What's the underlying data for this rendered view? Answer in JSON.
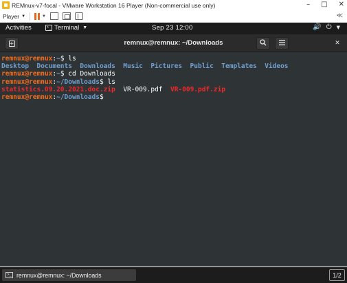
{
  "vm_window": {
    "title": "REMnux-v7-focal - VMware Workstation 16 Player (Non-commercial use only)",
    "controls": [
      "–",
      "□",
      "✕"
    ]
  },
  "vm_toolbar": {
    "player_label": "Player",
    "right_icon": "≪"
  },
  "gnome_bar": {
    "activities": "Activities",
    "app_menu": "Terminal",
    "clock": "Sep 23  12:00"
  },
  "terminal": {
    "title": "remnux@remnux: ~/Downloads",
    "lines": [
      {
        "user": "remnux@remnux",
        "path": "~",
        "cmd": "ls"
      },
      {
        "dirs": "Desktop  Documents  Downloads  Music  Pictures  Public  Templates  Videos"
      },
      {
        "user": "remnux@remnux",
        "path": "~",
        "cmd": "cd Downloads"
      },
      {
        "user": "remnux@remnux",
        "path": "~/Downloads",
        "cmd": "ls"
      },
      {
        "files": [
          "statistics.09.20.2021.doc.zip",
          "VR-009.pdf",
          "VR-009.pdf.zip"
        ]
      },
      {
        "user": "remnux@remnux",
        "path": "~/Downloads",
        "cmd": ""
      }
    ]
  },
  "taskbar": {
    "task_label": "remnux@remnux: ~/Downloads",
    "workspace": "1/2"
  },
  "colors": {
    "prompt_user": "#f36b1c",
    "prompt_path": "#729fcf",
    "archive": "#ef2929",
    "terminal_bg": "#2e3436"
  }
}
